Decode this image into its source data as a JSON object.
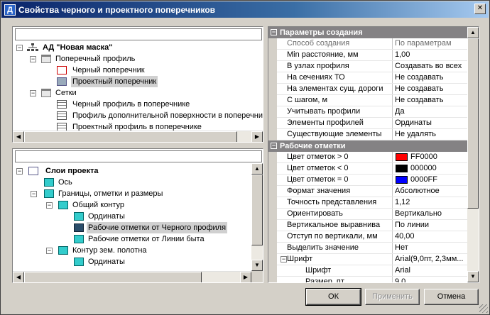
{
  "window": {
    "title": "Свойства черного и проектного поперечников",
    "app_icon_letter": "Д",
    "close_glyph": "✕"
  },
  "tree1": {
    "search_value": "",
    "root": "АД \"Новая маска\"",
    "items": [
      {
        "label": "Поперечный профиль"
      },
      {
        "label": "Черный поперечник"
      },
      {
        "label": "Проектный поперечник"
      },
      {
        "label": "Сетки"
      },
      {
        "label": "Черный профиль в поперечнике"
      },
      {
        "label": "Профиль дополнительной поверхности в поперечни"
      },
      {
        "label": "Проектный профиль в поперечнике"
      }
    ]
  },
  "tree2": {
    "search_value": "",
    "root": "Слои проекта",
    "items": [
      {
        "label": "Ось"
      },
      {
        "label": "Границы, отметки и  размеры"
      },
      {
        "label": "Общий контур"
      },
      {
        "label": "Ординаты"
      },
      {
        "label": "Рабочие отметки от Черного профиля"
      },
      {
        "label": "Рабочие отметки от Линии быта"
      },
      {
        "label": "Контур зем. полотна"
      },
      {
        "label": "Ординаты"
      }
    ]
  },
  "props": {
    "cat1": "Параметры создания",
    "rows1": [
      {
        "name": "Способ создания",
        "value": "По параметрам",
        "disabled": true
      },
      {
        "name": "Min расстояние, мм",
        "value": "1,00"
      },
      {
        "name": "В узлах профиля",
        "value": "Создавать во всех"
      },
      {
        "name": "На сечениях ТО",
        "value": "Не создавать"
      },
      {
        "name": "На элементах сущ. дороги",
        "value": "Не создавать"
      },
      {
        "name": "С шагом, м",
        "value": "Не создавать"
      },
      {
        "name": "Учитывать профили",
        "value": "Да"
      },
      {
        "name": "Элементы профилей",
        "value": "Ординаты"
      },
      {
        "name": "Существующие элементы",
        "value": "Не удалять"
      }
    ],
    "cat2": "Рабочие отметки",
    "rows2": [
      {
        "name": "Цвет отметок > 0",
        "value": "FF0000",
        "color": "#ff0000"
      },
      {
        "name": "Цвет отметок < 0",
        "value": "000000",
        "color": "#000000"
      },
      {
        "name": "Цвет отметок = 0",
        "value": "0000FF",
        "color": "#0000ff"
      },
      {
        "name": "Формат значения",
        "value": "Абсолютное"
      },
      {
        "name": "Точность представления",
        "value": "1,12"
      },
      {
        "name": "Ориентировать",
        "value": "Вертикально"
      },
      {
        "name": "Вертикальное выравнива",
        "value": "По линии"
      },
      {
        "name": "Отступ по вертикали, мм",
        "value": "40,00"
      },
      {
        "name": "Выделить значение",
        "value": "Нет"
      },
      {
        "name": "Шрифт",
        "value": "Arial(9,0пт, 2,3мм..."
      },
      {
        "name": "Шрифт",
        "value": "Arial"
      },
      {
        "name": "Размер, пт",
        "value": "9,0"
      }
    ]
  },
  "buttons": {
    "ok": "ОК",
    "apply": "Применить",
    "cancel": "Отмена"
  },
  "scroll": {
    "up": "▲",
    "down": "▼",
    "left": "◀",
    "right": "▶"
  },
  "expander": {
    "minus": "−",
    "plus": "+"
  }
}
